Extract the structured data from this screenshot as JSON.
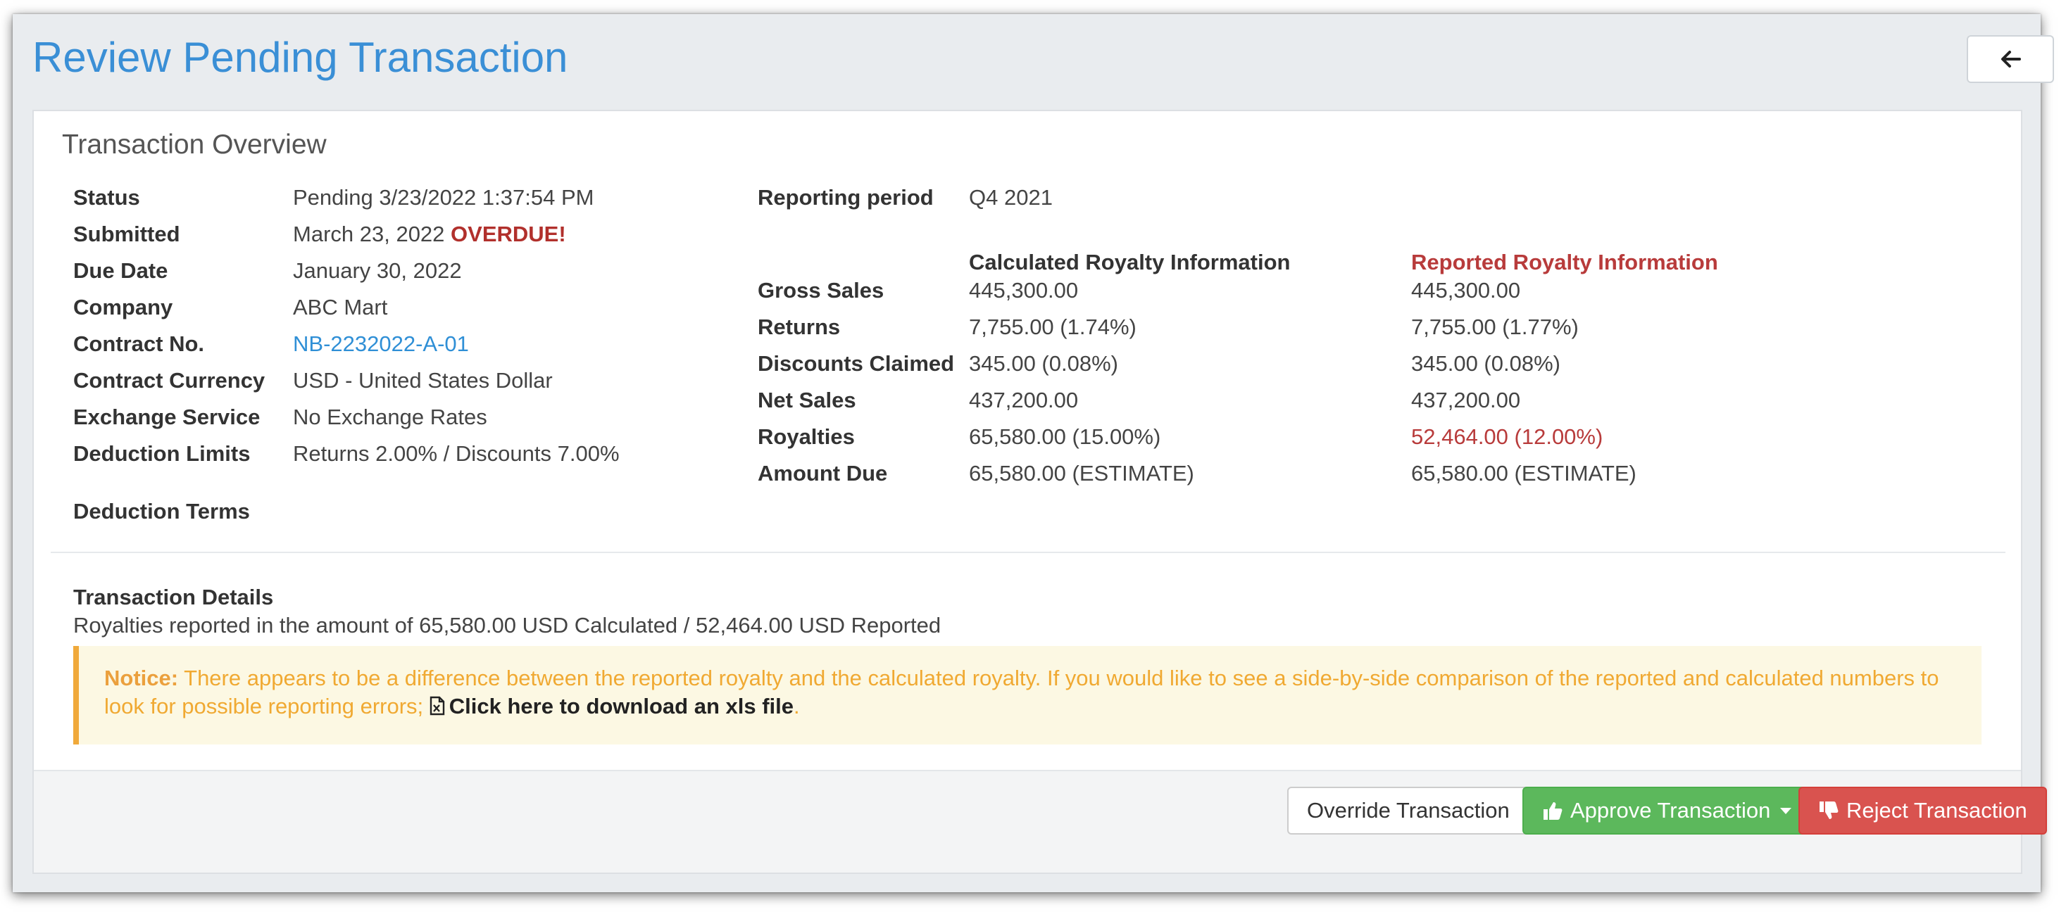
{
  "page": {
    "title": "Review Pending Transaction"
  },
  "overview": {
    "heading": "Transaction Overview",
    "fields": {
      "status": {
        "label": "Status",
        "value": "Pending 3/23/2022 1:37:54 PM"
      },
      "submitted": {
        "label": "Submitted",
        "value": "March 23, 2022",
        "flag": "OVERDUE!"
      },
      "due_date": {
        "label": "Due Date",
        "value": "January 30, 2022"
      },
      "company": {
        "label": "Company",
        "value": "ABC Mart"
      },
      "contract_no": {
        "label": "Contract No.",
        "value": "NB-2232022-A-01"
      },
      "contract_currency": {
        "label": "Contract Currency",
        "value": "USD - United States Dollar"
      },
      "exchange_service": {
        "label": "Exchange Service",
        "value": "No Exchange Rates"
      },
      "deduction_limits": {
        "label": "Deduction Limits",
        "value": "Returns 2.00% / Discounts 7.00%"
      },
      "deduction_terms": {
        "label": "Deduction Terms",
        "value": ""
      }
    },
    "reporting_period": {
      "label": "Reporting period",
      "value": "Q4 2021"
    },
    "royalty": {
      "calculated_heading": "Calculated Royalty Information",
      "reported_heading": "Reported Royalty Information",
      "rows": [
        {
          "label": "Gross Sales",
          "calculated": "445,300.00",
          "reported": "445,300.00"
        },
        {
          "label": "Returns",
          "calculated": "7,755.00 (1.74%)",
          "reported": "7,755.00 (1.77%)"
        },
        {
          "label": "Discounts Claimed",
          "calculated": "345.00 (0.08%)",
          "reported": "345.00 (0.08%)"
        },
        {
          "label": "Net Sales",
          "calculated": "437,200.00",
          "reported": "437,200.00"
        },
        {
          "label": "Royalties",
          "calculated": "65,580.00 (15.00%)",
          "reported": "52,464.00 (12.00%)"
        },
        {
          "label": "Amount Due",
          "calculated": "65,580.00 (ESTIMATE)",
          "reported": "65,580.00 (ESTIMATE)"
        }
      ]
    }
  },
  "details": {
    "title": "Transaction Details",
    "text": "Royalties reported in the amount of 65,580.00 USD Calculated / 52,464.00 USD Reported"
  },
  "notice": {
    "prefix": "Notice:",
    "message": " There appears to be a difference between the reported royalty and the calculated royalty. If you would like to see a side-by-side comparison of the reported and calculated numbers to look for possible reporting errors; ",
    "link_text": "Click here to download an xls file",
    "suffix": "."
  },
  "footer": {
    "override_label": "Override Transaction",
    "approve_label": "Approve Transaction",
    "reject_label": "Reject Transaction"
  },
  "colors": {
    "title_blue": "#3a8fd6",
    "overdue_red": "#b1302c",
    "reported_red": "#b83b3b",
    "notice_orange": "#f0a932",
    "approve_green": "#5cb85c",
    "reject_red": "#d9534f"
  },
  "icons": {
    "back": "arrow-left-icon",
    "xls": "file-excel-icon",
    "approve": "thumbs-up-icon",
    "reject": "thumbs-down-icon",
    "dropdown": "caret-down-icon"
  }
}
